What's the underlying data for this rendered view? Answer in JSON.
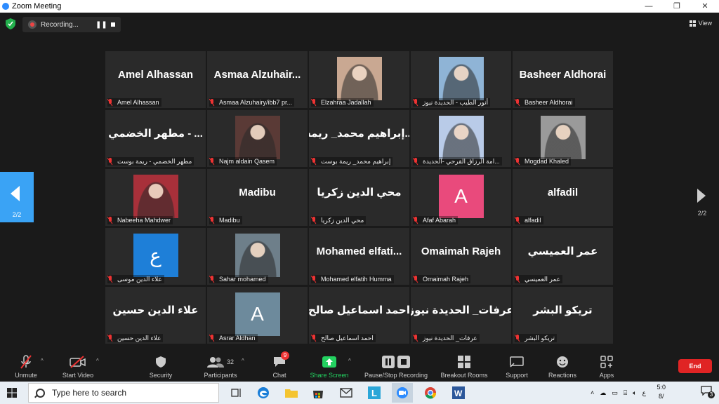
{
  "window": {
    "title": "Zoom Meeting",
    "minimize": "—",
    "maximize": "❐",
    "close": "✕"
  },
  "topbar": {
    "recording_label": "Recording...",
    "pause": "❚❚",
    "view_label": "View"
  },
  "pagination": {
    "left_page": "2/2",
    "right_page": "2/2"
  },
  "participants": [
    {
      "display": "Amel Alhassan",
      "label": "Amel Alhassan"
    },
    {
      "display": "Asmaa  Alzuhair...",
      "label": "Asmaa Alzuhairy/ibb7 pr..."
    },
    {
      "display": "",
      "label": "Elzahraa Jadallah",
      "photo": "#c9a892"
    },
    {
      "display": "",
      "label": "أنور الطيب - الحديدة نيوز",
      "photo": "#8fb4d6"
    },
    {
      "display": "Basheer Aldhorai",
      "label": "Basheer Aldhorai"
    },
    {
      "display": "مطهر الخضمي - ...",
      "label": "مطهر الخضمي - ريمة بوست"
    },
    {
      "display": "",
      "label": "Najm aldain Qasem",
      "photo": "#5a3a36"
    },
    {
      "display": "إبراهيم محمد_ ريمة...",
      "label": "إبراهيم محمد_ ريمة بوست"
    },
    {
      "display": "",
      "label": "امة الرزاق القرحي -الحديدة...",
      "photo": "#b9cbe8"
    },
    {
      "display": "",
      "label": "Mogdad Khaled",
      "photo": "#9a9a9a"
    },
    {
      "display": "",
      "label": "Nabeeha Mahdwer",
      "photo": "#a8303a"
    },
    {
      "display": "Madibu",
      "label": "Madibu"
    },
    {
      "display": "محي الدين زكريا",
      "label": "محي الدين زكريا"
    },
    {
      "display": "",
      "label": "Afaf Abarah",
      "avatar": "A",
      "avatar_color": "#e94a7c"
    },
    {
      "display": "alfadil",
      "label": "alfadil"
    },
    {
      "display": "",
      "label": "علاء الدين موسى",
      "avatar": "ع",
      "avatar_color": "#1e7fd8"
    },
    {
      "display": "",
      "label": "Sahar mohamed",
      "photo": "#6e7f8a"
    },
    {
      "display": "Mohamed  elfati...",
      "label": "Mohamed elfatih Humma"
    },
    {
      "display": "Omaimah Rajeh",
      "label": "Omaimah Rajeh"
    },
    {
      "display": "عمر العميسي",
      "label": "عمر العميسي"
    },
    {
      "display": "علاء الدين حسين",
      "label": "علاء الدين حسين"
    },
    {
      "display": "",
      "label": "Asrar Aldhan",
      "avatar": "A",
      "avatar_color": "#6d8a9c"
    },
    {
      "display": "احمد اسماعيل صالح",
      "label": "احمد اسماعيل صالح"
    },
    {
      "display": "عرفات_ الحديدة نيوز",
      "label": "عرفات_ الحديدة نيوز"
    },
    {
      "display": "تريكو البشر",
      "label": "تريكو البشر"
    }
  ],
  "toolbar": {
    "unmute": "Unmute",
    "start_video": "Start Video",
    "security": "Security",
    "participants": "Participants",
    "participant_count": "32",
    "chat": "Chat",
    "chat_badge": "9",
    "share_screen": "Share Screen",
    "pause_recording": "Pause/Stop Recording",
    "breakout_rooms": "Breakout Rooms",
    "support": "Support",
    "reactions": "Reactions",
    "apps": "Apps",
    "end": "End",
    "share_color": "#23d160",
    "end_color": "#e02424"
  },
  "taskbar": {
    "search_placeholder": "Type here to search",
    "clock_time": "5:0",
    "clock_date": "8/",
    "lang": "ع",
    "notifications": "3"
  }
}
